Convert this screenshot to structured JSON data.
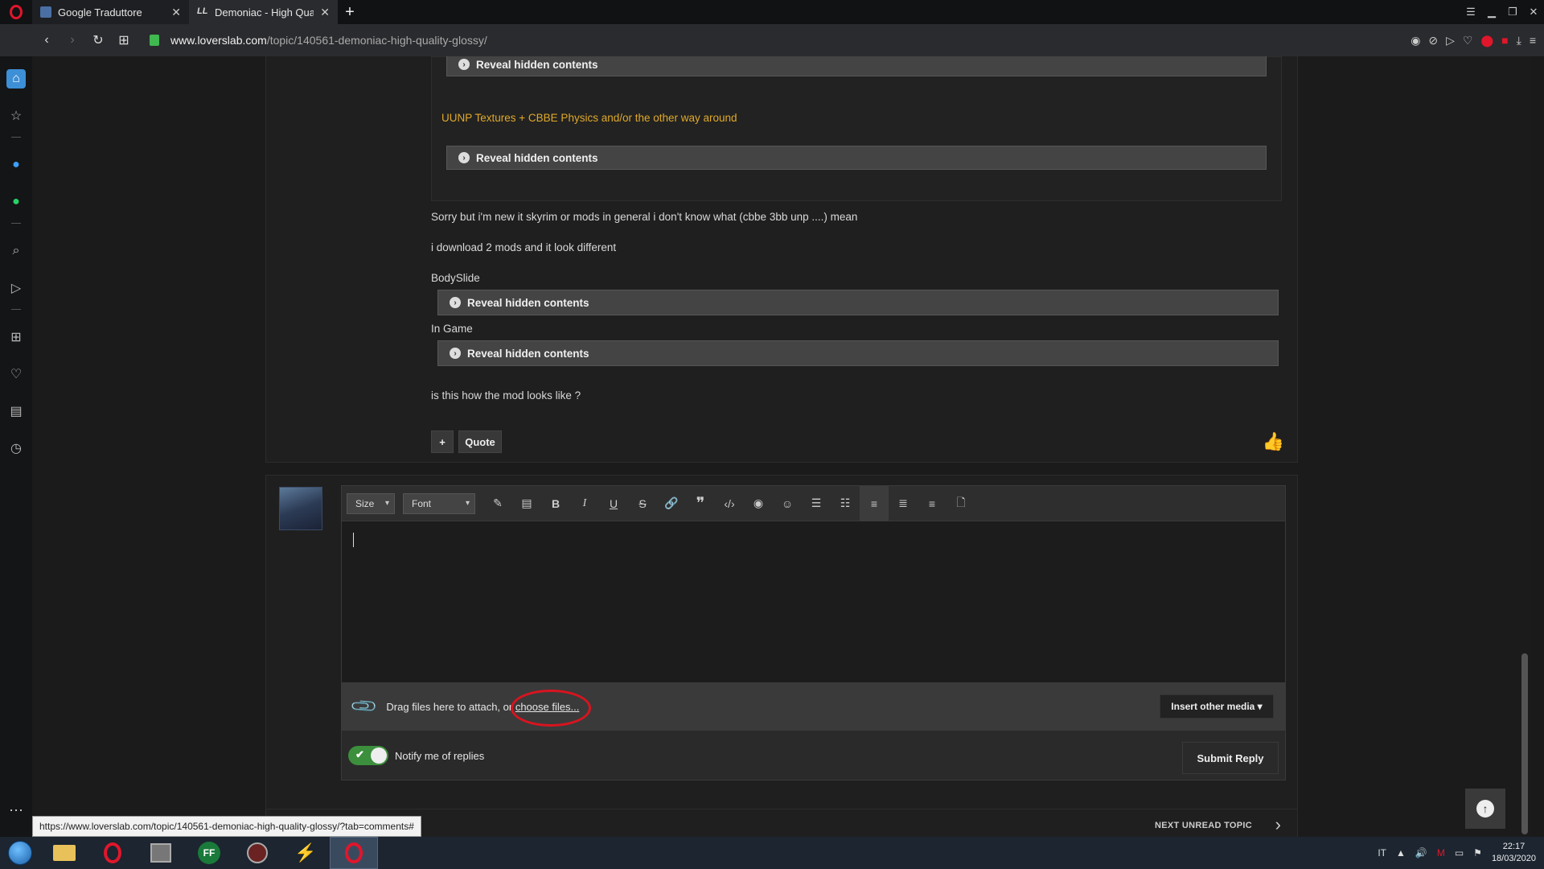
{
  "tabs": [
    {
      "title": "Google Traduttore",
      "active": false
    },
    {
      "title": "Demoniac - High Quality G",
      "active": true
    }
  ],
  "address": {
    "host": "www.loverslab.com",
    "path": "/topic/140561-demoniac-high-quality-glossy/"
  },
  "post": {
    "reveal_label": "Reveal hidden contents",
    "quote_line": "UUNP Textures + CBBE  Physics and/or the other way around",
    "line1": "Sorry but i'm new it skyrim or mods in general i don't know what (cbbe 3bb unp ....) mean",
    "line2": "i download 2 mods and it look different",
    "label_bodyslide": "BodySlide",
    "label_ingame": "In Game",
    "line3": "is this how the mod looks like ?",
    "plus_label": "+",
    "quote_label": "Quote"
  },
  "editor": {
    "size_label": "Size",
    "font_label": "Font",
    "attach_text": "Drag files here to attach, or ",
    "choose_files": "choose files...",
    "insert_media": "Insert other media ▾",
    "notify_label": "Notify me of replies",
    "notify_enabled": true,
    "submit_label": "Submit Reply"
  },
  "next_unread": "NEXT UNREAD TOPIC",
  "status_url": "https://www.loverslab.com/topic/140561-demoniac-high-quality-glossy/?tab=comments#",
  "taskbar": {
    "lang": "IT",
    "time": "22:17",
    "date": "18/03/2020"
  },
  "colors": {
    "accent_gold": "#e0a92a",
    "toggle_green": "#3c8f3c",
    "annotation_red": "#d8141f"
  }
}
